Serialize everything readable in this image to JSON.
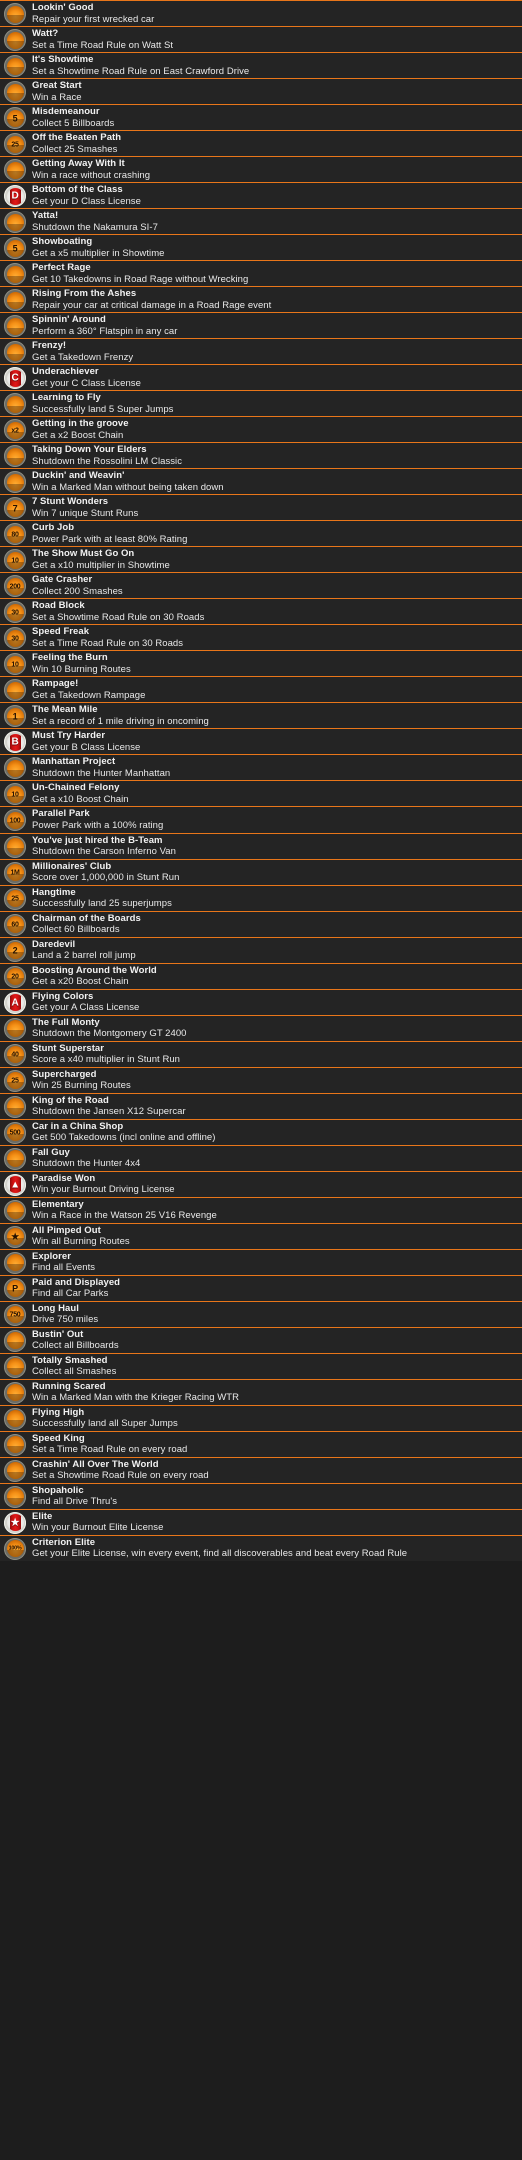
{
  "theme": {
    "background": "#1d1d1d",
    "row_background": "#242424",
    "divider": "#e8761a",
    "title_color": "#f2f2f2",
    "description_color": "#e9e9e9",
    "badge_orange": "#f59016",
    "badge_red": "#cc1111"
  },
  "list": {
    "name": "Burnout Paradise Achievements",
    "items": [
      {
        "icon": "trophy-icon",
        "glyph": "",
        "badge": "orange",
        "title": "Lookin' Good",
        "description": "Repair your first wrecked car"
      },
      {
        "icon": "trophy-icon",
        "glyph": "",
        "badge": "orange",
        "title": "Watt?",
        "description": "Set a Time Road Rule on Watt St"
      },
      {
        "icon": "trophy-icon",
        "glyph": "",
        "badge": "orange",
        "title": "It's Showtime",
        "description": "Set a Showtime Road Rule on East Crawford Drive"
      },
      {
        "icon": "trophy-icon",
        "glyph": "",
        "badge": "orange",
        "title": "Great Start",
        "description": "Win a Race"
      },
      {
        "icon": "trophy-icon",
        "glyph": "5",
        "badge": "orange",
        "title": "Misdemeanour",
        "description": "Collect 5 Billboards"
      },
      {
        "icon": "trophy-icon",
        "glyph": "25",
        "badge": "orange",
        "title": "Off the Beaten Path",
        "description": "Collect 25 Smashes"
      },
      {
        "icon": "trophy-icon",
        "glyph": "",
        "badge": "orange",
        "title": "Getting Away With It",
        "description": "Win a race without crashing"
      },
      {
        "icon": "license-badge-icon",
        "glyph": "D",
        "badge": "red",
        "title": "Bottom of the Class",
        "description": "Get your D Class License"
      },
      {
        "icon": "trophy-icon",
        "glyph": "",
        "badge": "orange",
        "title": "Yatta!",
        "description": "Shutdown the Nakamura SI-7"
      },
      {
        "icon": "trophy-icon",
        "glyph": "5",
        "badge": "orange",
        "title": "Showboating",
        "description": "Get a x5 multiplier in Showtime"
      },
      {
        "icon": "trophy-icon",
        "glyph": "",
        "badge": "orange",
        "title": "Perfect Rage",
        "description": "Get 10 Takedowns in Road Rage without Wrecking"
      },
      {
        "icon": "trophy-icon",
        "glyph": "",
        "badge": "orange",
        "title": "Rising From the Ashes",
        "description": "Repair your car at critical damage in a Road Rage event"
      },
      {
        "icon": "trophy-icon",
        "glyph": "",
        "badge": "orange",
        "title": "Spinnin' Around",
        "description": "Perform a 360° Flatspin in any car"
      },
      {
        "icon": "trophy-icon",
        "glyph": "",
        "badge": "orange",
        "title": "Frenzy!",
        "description": "Get a Takedown Frenzy"
      },
      {
        "icon": "license-badge-icon",
        "glyph": "C",
        "badge": "red",
        "title": "Underachiever",
        "description": "Get your C Class License"
      },
      {
        "icon": "trophy-icon",
        "glyph": "",
        "badge": "orange",
        "title": "Learning to Fly",
        "description": "Successfully land 5 Super Jumps"
      },
      {
        "icon": "trophy-icon",
        "glyph": "x2",
        "badge": "orange",
        "title": "Getting in the groove",
        "description": "Get a x2 Boost Chain"
      },
      {
        "icon": "trophy-icon",
        "glyph": "",
        "badge": "orange",
        "title": "Taking Down Your Elders",
        "description": "Shutdown the Rossolini LM Classic"
      },
      {
        "icon": "trophy-icon",
        "glyph": "",
        "badge": "orange",
        "title": "Duckin' and Weavin'",
        "description": "Win a Marked Man without being taken down"
      },
      {
        "icon": "trophy-icon",
        "glyph": "7",
        "badge": "orange",
        "title": "7 Stunt Wonders",
        "description": "Win 7 unique Stunt Runs"
      },
      {
        "icon": "trophy-icon",
        "glyph": "80",
        "badge": "orange",
        "title": "Curb Job",
        "description": "Power Park with at least 80% Rating"
      },
      {
        "icon": "trophy-icon",
        "glyph": "10",
        "badge": "orange",
        "title": "The Show Must Go On",
        "description": "Get a x10 multiplier in Showtime"
      },
      {
        "icon": "trophy-icon",
        "glyph": "200",
        "badge": "orange",
        "title": "Gate Crasher",
        "description": "Collect 200 Smashes"
      },
      {
        "icon": "trophy-icon",
        "glyph": "30",
        "badge": "orange",
        "title": "Road Block",
        "description": "Set a Showtime Road Rule on 30 Roads"
      },
      {
        "icon": "trophy-icon",
        "glyph": "30",
        "badge": "orange",
        "title": "Speed Freak",
        "description": "Set a Time Road Rule on 30 Roads"
      },
      {
        "icon": "trophy-icon",
        "glyph": "10",
        "badge": "orange",
        "title": "Feeling the Burn",
        "description": "Win 10 Burning Routes"
      },
      {
        "icon": "trophy-icon",
        "glyph": "",
        "badge": "orange",
        "title": "Rampage!",
        "description": "Get a Takedown Rampage"
      },
      {
        "icon": "trophy-icon",
        "glyph": "1",
        "badge": "orange",
        "title": "The Mean Mile",
        "description": "Set a record of 1 mile driving in oncoming"
      },
      {
        "icon": "license-badge-icon",
        "glyph": "B",
        "badge": "red",
        "title": "Must Try Harder",
        "description": "Get your B Class License"
      },
      {
        "icon": "trophy-icon",
        "glyph": "",
        "badge": "orange",
        "title": "Manhattan Project",
        "description": "Shutdown the Hunter Manhattan"
      },
      {
        "icon": "trophy-icon",
        "glyph": "10",
        "badge": "orange",
        "title": "Un-Chained Felony",
        "description": "Get a x10 Boost Chain"
      },
      {
        "icon": "trophy-icon",
        "glyph": "100",
        "badge": "orange",
        "title": "Parallel Park",
        "description": "Power Park with a 100% rating"
      },
      {
        "icon": "trophy-icon",
        "glyph": "",
        "badge": "orange",
        "title": "You've just hired the B-Team",
        "description": "Shutdown the Carson Inferno Van"
      },
      {
        "icon": "trophy-icon",
        "glyph": "1M",
        "badge": "orange",
        "title": "Millionaires' Club",
        "description": "Score over 1,000,000 in Stunt Run"
      },
      {
        "icon": "trophy-icon",
        "glyph": "25",
        "badge": "orange",
        "title": "Hangtime",
        "description": "Successfully land 25 superjumps"
      },
      {
        "icon": "trophy-icon",
        "glyph": "60",
        "badge": "orange",
        "title": "Chairman of the Boards",
        "description": "Collect 60 Billboards"
      },
      {
        "icon": "trophy-icon",
        "glyph": "2",
        "badge": "orange",
        "title": "Daredevil",
        "description": "Land a 2 barrel roll jump"
      },
      {
        "icon": "trophy-icon",
        "glyph": "20",
        "badge": "orange",
        "title": "Boosting Around the World",
        "description": "Get a x20 Boost Chain"
      },
      {
        "icon": "license-badge-icon",
        "glyph": "A",
        "badge": "red",
        "title": "Flying Colors",
        "description": "Get your A Class License"
      },
      {
        "icon": "trophy-icon",
        "glyph": "",
        "badge": "orange",
        "title": "The Full Monty",
        "description": "Shutdown the Montgomery GT 2400"
      },
      {
        "icon": "trophy-icon",
        "glyph": "40",
        "badge": "orange",
        "title": "Stunt Superstar",
        "description": "Score a x40 multiplier in Stunt Run"
      },
      {
        "icon": "trophy-icon",
        "glyph": "25",
        "badge": "orange",
        "title": "Supercharged",
        "description": "Win 25 Burning Routes"
      },
      {
        "icon": "trophy-icon",
        "glyph": "",
        "badge": "orange",
        "title": "King of the Road",
        "description": "Shutdown the Jansen X12 Supercar"
      },
      {
        "icon": "trophy-icon",
        "glyph": "500",
        "badge": "orange",
        "title": "Car in a China Shop",
        "description": "Get 500 Takedowns (incl online and offline)"
      },
      {
        "icon": "trophy-icon",
        "glyph": "",
        "badge": "orange",
        "title": "Fall Guy",
        "description": "Shutdown the Hunter 4x4"
      },
      {
        "icon": "license-badge-icon",
        "glyph": "▲",
        "badge": "red",
        "title": "Paradise Won",
        "description": "Win your Burnout Driving License"
      },
      {
        "icon": "trophy-icon",
        "glyph": "",
        "badge": "orange",
        "title": "Elementary",
        "description": "Win a Race in the Watson 25 V16 Revenge"
      },
      {
        "icon": "trophy-icon",
        "glyph": "★",
        "badge": "orange",
        "title": "All Pimped Out",
        "description": "Win all Burning Routes"
      },
      {
        "icon": "trophy-icon",
        "glyph": "",
        "badge": "orange",
        "title": "Explorer",
        "description": "Find all Events"
      },
      {
        "icon": "trophy-icon",
        "glyph": "P",
        "badge": "orange",
        "title": "Paid and Displayed",
        "description": "Find all Car Parks"
      },
      {
        "icon": "trophy-icon",
        "glyph": "750",
        "badge": "orange",
        "title": "Long Haul",
        "description": "Drive 750 miles"
      },
      {
        "icon": "trophy-icon",
        "glyph": "",
        "badge": "orange",
        "title": "Bustin' Out",
        "description": "Collect all Billboards"
      },
      {
        "icon": "trophy-icon",
        "glyph": "",
        "badge": "orange",
        "title": "Totally Smashed",
        "description": "Collect all Smashes"
      },
      {
        "icon": "trophy-icon",
        "glyph": "",
        "badge": "orange",
        "title": "Running Scared",
        "description": "Win a Marked Man with the Krieger Racing WTR"
      },
      {
        "icon": "trophy-icon",
        "glyph": "",
        "badge": "orange",
        "title": "Flying High",
        "description": "Successfully land all Super Jumps"
      },
      {
        "icon": "trophy-icon",
        "glyph": "",
        "badge": "orange",
        "title": "Speed King",
        "description": "Set a Time Road Rule on every road"
      },
      {
        "icon": "trophy-icon",
        "glyph": "",
        "badge": "orange",
        "title": "Crashin' All Over The World",
        "description": "Set a Showtime Road Rule on every road"
      },
      {
        "icon": "trophy-icon",
        "glyph": "",
        "badge": "orange",
        "title": "Shopaholic",
        "description": "Find all Drive Thru's"
      },
      {
        "icon": "license-badge-icon",
        "glyph": "★",
        "badge": "red",
        "title": "Elite",
        "description": "Win your Burnout Elite License"
      },
      {
        "icon": "trophy-icon",
        "glyph": "100%",
        "badge": "orange",
        "title": "Criterion Elite",
        "description": "Get your Elite License, win every event, find all discoverables and beat every Road Rule"
      }
    ]
  }
}
